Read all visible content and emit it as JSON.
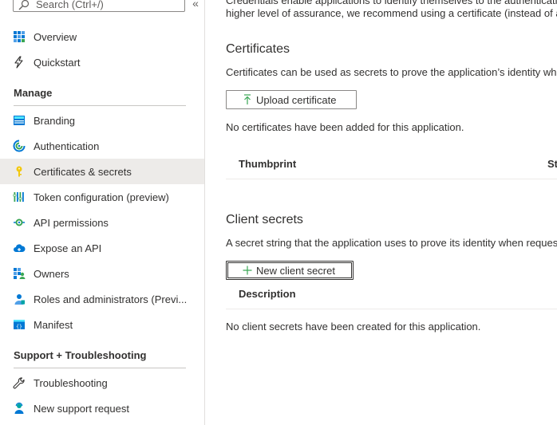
{
  "search": {
    "placeholder": "Search (Ctrl+/)"
  },
  "sidebar": {
    "items_top": [
      {
        "label": "Overview",
        "icon": "overview-grid-icon"
      },
      {
        "label": "Quickstart",
        "icon": "lightning-icon"
      }
    ],
    "manage_header": "Manage",
    "manage_items": [
      {
        "label": "Branding",
        "icon": "branding-icon"
      },
      {
        "label": "Authentication",
        "icon": "authentication-icon"
      },
      {
        "label": "Certificates & secrets",
        "icon": "key-icon",
        "active": true
      },
      {
        "label": "Token configuration (preview)",
        "icon": "token-bars-icon"
      },
      {
        "label": "API permissions",
        "icon": "api-permissions-icon"
      },
      {
        "label": "Expose an API",
        "icon": "cloud-icon"
      },
      {
        "label": "Owners",
        "icon": "owners-icon"
      },
      {
        "label": "Roles and administrators (Previ...",
        "icon": "roles-icon"
      },
      {
        "label": "Manifest",
        "icon": "manifest-icon"
      }
    ],
    "support_header": "Support + Troubleshooting",
    "support_items": [
      {
        "label": "Troubleshooting",
        "icon": "wrench-icon"
      },
      {
        "label": "New support request",
        "icon": "support-person-icon"
      }
    ]
  },
  "main": {
    "intro_line1": "Credentials enable applications to identify themselves to the authenticati",
    "intro_line2": "higher level of assurance, we recommend using a certificate (instead of a",
    "certificates": {
      "title": "Certificates",
      "description": "Certificates can be used as secrets to prove the application’s identity whe",
      "upload_button": "Upload certificate",
      "empty_message": "No certificates have been added for this application.",
      "columns": [
        "Thumbprint",
        "St"
      ]
    },
    "client_secrets": {
      "title": "Client secrets",
      "description": "A secret string that the application uses to prove its identity when reques",
      "new_button": "New client secret",
      "columns": [
        "Description"
      ],
      "empty_message": "No client secrets have been created for this application."
    }
  },
  "colors": {
    "accent": "#0078d4",
    "active_bg": "#edebe9",
    "key_yellow": "#f2c811",
    "green": "#3aa655",
    "teal": "#00a4a6"
  }
}
